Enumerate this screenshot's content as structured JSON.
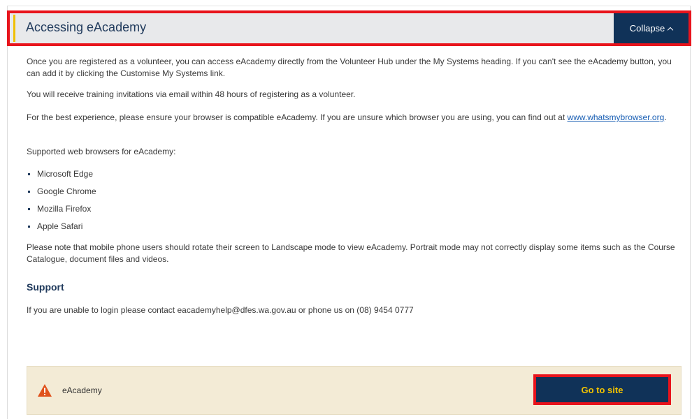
{
  "accordion": {
    "title": "Accessing eAcademy",
    "collapse_label": "Collapse"
  },
  "content": {
    "paragraph1": "Once you are registered as a volunteer, you can access eAcademy directly from the Volunteer Hub under the My Systems heading. If you can't see the eAcademy button, you can add it by clicking the Customise My Systems link.",
    "paragraph2": "You will receive training invitations via email within 48 hours of registering as a volunteer.",
    "paragraph3_text": "For the best experience, please ensure your browser is compatible eAcademy. If you are unsure which browser you are using, you can find out at ",
    "paragraph3_link": "www.whatsmybrowser.org",
    "paragraph3_end": ".",
    "browsers_intro": "Supported web browsers for eAcademy:",
    "browsers": [
      "Microsoft Edge",
      "Google Chrome",
      "Mozilla Firefox",
      "Apple Safari"
    ],
    "paragraph5": "Please note that mobile phone users should rotate their screen to Landscape mode to view eAcademy. Portrait mode may not correctly display some items such as the Course Catalogue, document files and videos.",
    "support_heading": "Support",
    "support_text": "If you are unable to login please contact eacademyhelp@dfes.wa.gov.au or phone us on (08) 9454 0777"
  },
  "site_box": {
    "icon": "warning-triangle-icon",
    "label": "eAcademy",
    "button_label": "Go to site"
  },
  "colors": {
    "navy": "#103258",
    "accent_yellow": "#f2c200",
    "highlight_red": "#e8141c",
    "warning_orange": "#e0521c",
    "site_box_bg": "#f3ebd6"
  }
}
